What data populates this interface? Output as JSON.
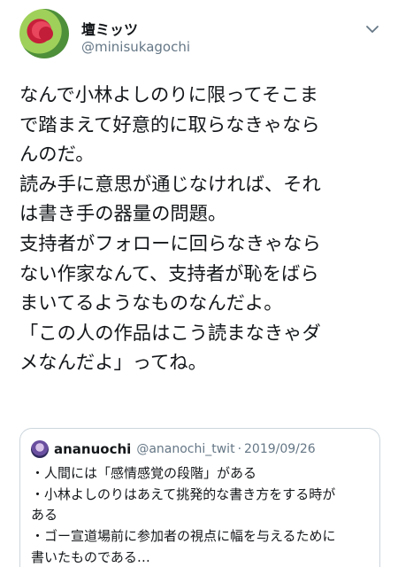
{
  "author": {
    "display_name": "壇ミッツ",
    "handle": "@minisukagochi",
    "avatar_icon": "rose-avatar",
    "menu_icon": "chevron-down-icon"
  },
  "tweet": {
    "lines": [
      "なんで小林よしのりに限ってそこま",
      "で踏まえて好意的に取らなきゃなら",
      "んのだ。",
      "読み手に意思が通じなければ、それ",
      "は書き手の器量の問題。",
      "支持者がフォローに回らなきゃなら",
      "ない作家なんて、支持者が恥をばら",
      "まいてるようなものなんだよ。",
      "「この人の作品はこう読まなきゃダ",
      "メなんだよ」ってね。"
    ]
  },
  "quoted": {
    "name": "ananuochi",
    "handle": "@ananochi_twit",
    "separator": "·",
    "date": "2019/09/26",
    "lines": [
      "・人間には「感情感覚の段階」がある",
      "・小林よしのりはあえて挑発的な書き方をする時が",
      "ある",
      "・ゴー宣道場前に参加者の視点に幅を与えるために",
      "書いたものである…"
    ]
  },
  "colors": {
    "text": "#14171a",
    "secondary": "#657786",
    "border": "#ccd6dd"
  }
}
